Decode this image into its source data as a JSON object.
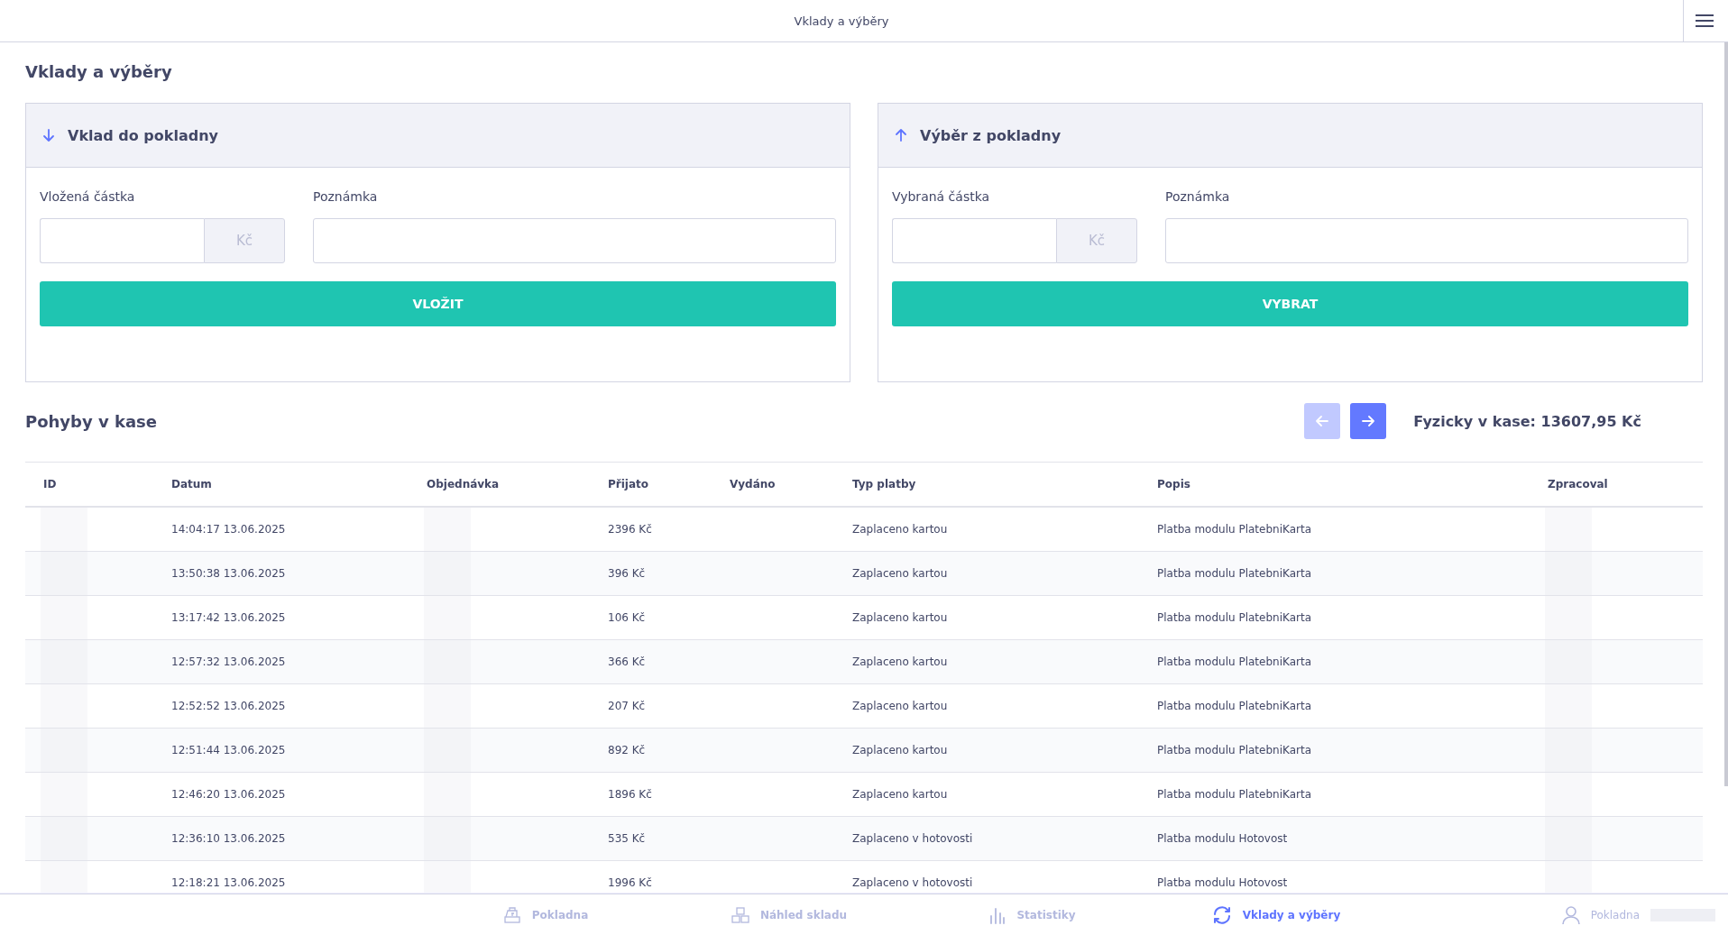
{
  "header": {
    "title": "Vklady a výběry"
  },
  "page_title": "Vklady a výběry",
  "panels": [
    {
      "kind": "deposit",
      "title": "Vklad do pokladny",
      "amount_label": "Vložená částka",
      "currency": "Kč",
      "note_label": "Poznámka",
      "button": "VLOŽIT"
    },
    {
      "kind": "withdrawal",
      "title": "Výběr z pokladny",
      "amount_label": "Vybraná částka",
      "currency": "Kč",
      "note_label": "Poznámka",
      "button": "VYBRAT"
    }
  ],
  "movements": {
    "title": "Pohyby v kase",
    "pager": [
      {
        "kind": "prev",
        "disabled": true
      },
      {
        "kind": "next",
        "disabled": false
      }
    ],
    "cash_total": "Fyzicky v kase: 13607,95 Kč",
    "columns": [
      "ID",
      "Datum",
      "Objednávka",
      "Přijato",
      "Vydáno",
      "Typ platby",
      "Popis",
      "Zpracoval"
    ],
    "rows": [
      {
        "date": "14:04:17 13.06.2025",
        "received": "2396 Kč",
        "payment_type": "Zaplaceno kartou",
        "description": "Platba modulu PlatebniKarta"
      },
      {
        "date": "13:50:38 13.06.2025",
        "received": "396 Kč",
        "payment_type": "Zaplaceno kartou",
        "description": "Platba modulu PlatebniKarta"
      },
      {
        "date": "13:17:42 13.06.2025",
        "received": "106 Kč",
        "payment_type": "Zaplaceno kartou",
        "description": "Platba modulu PlatebniKarta"
      },
      {
        "date": "12:57:32 13.06.2025",
        "received": "366 Kč",
        "payment_type": "Zaplaceno kartou",
        "description": "Platba modulu PlatebniKarta"
      },
      {
        "date": "12:52:52 13.06.2025",
        "received": "207 Kč",
        "payment_type": "Zaplaceno kartou",
        "description": "Platba modulu PlatebniKarta"
      },
      {
        "date": "12:51:44 13.06.2025",
        "received": "892 Kč",
        "payment_type": "Zaplaceno kartou",
        "description": "Platba modulu PlatebniKarta"
      },
      {
        "date": "12:46:20 13.06.2025",
        "received": "1896 Kč",
        "payment_type": "Zaplaceno kartou",
        "description": "Platba modulu PlatebniKarta"
      },
      {
        "date": "12:36:10 13.06.2025",
        "received": "535 Kč",
        "payment_type": "Zaplaceno v hotovosti",
        "description": "Platba modulu Hotovost"
      },
      {
        "date": "12:18:21 13.06.2025",
        "received": "1996 Kč",
        "payment_type": "Zaplaceno v hotovosti",
        "description": "Platba modulu Hotovost"
      }
    ]
  },
  "bottom_nav": {
    "items": [
      {
        "kind": "register",
        "label": "Pokladna",
        "selected": false
      },
      {
        "kind": "warehouse",
        "label": "Náhled skladu",
        "selected": false
      },
      {
        "kind": "stats",
        "label": "Statistiky",
        "selected": false
      },
      {
        "kind": "cash-flow",
        "label": "Vklady a výběry",
        "selected": true
      }
    ],
    "user": {
      "label": "Pokladna"
    }
  }
}
